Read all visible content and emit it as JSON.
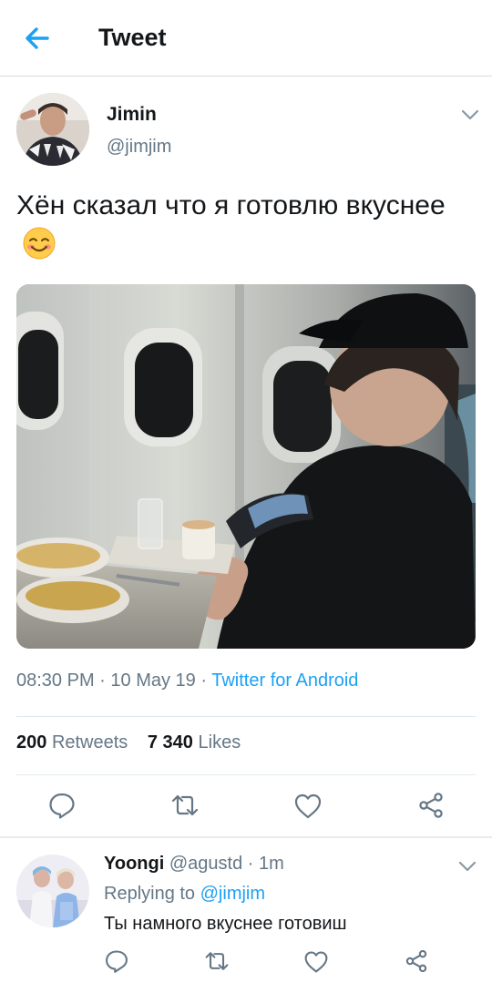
{
  "header": {
    "title": "Tweet",
    "back_icon": "arrow-left-icon",
    "accent": "#1da1f2"
  },
  "tweet": {
    "author_name": "Jimin",
    "author_handle": "@jimjim",
    "text": "Хён сказал что я готовлю вкуснее",
    "emoji": "smiling-face-icon",
    "time": "08:30 PM",
    "date": "10 May 19",
    "source": "Twitter for Android",
    "retweets_count": "200",
    "retweets_label": "Retweets",
    "likes_count": "7 340",
    "likes_label": "Likes",
    "actions": [
      "reply-icon",
      "retweet-icon",
      "like-icon",
      "share-icon"
    ]
  },
  "reply": {
    "author_name": "Yoongi",
    "author_handle": "@agustd",
    "time": "1m",
    "replying_label": "Replying to",
    "replying_to": "@jimjim",
    "text": "Ты намного вкуснее готовиш"
  }
}
